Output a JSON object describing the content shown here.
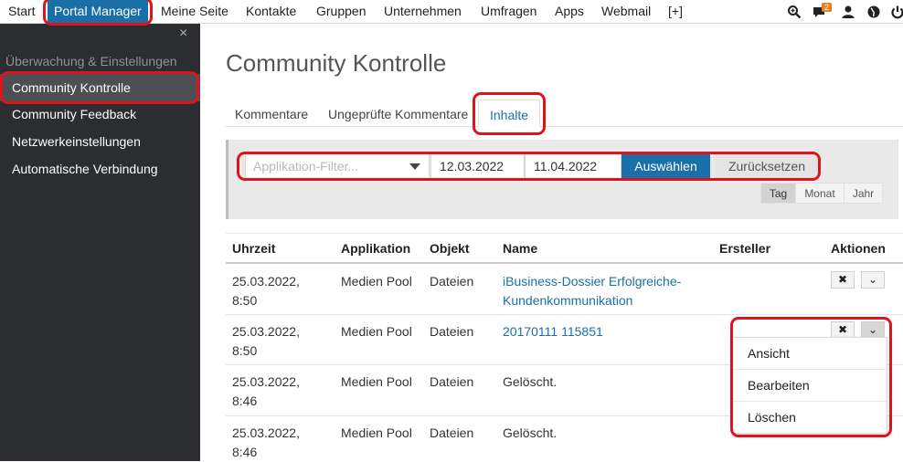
{
  "topbar": {
    "nav": [
      "Start",
      "Portal Manager",
      "Meine Seite",
      "Kontakte",
      "Gruppen",
      "Unternehmen",
      "Umfragen",
      "Apps",
      "Webmail",
      "[+]"
    ],
    "active_index": 1,
    "icons": [
      "zoom-icon",
      "chat-icon",
      "user-icon",
      "globe-icon",
      "power-icon"
    ],
    "chat_badge": "2",
    "accent_color": "#1b6fa8",
    "badge_color": "#f07d1a"
  },
  "sidebar": {
    "close_glyph": "×",
    "section_title": "Überwachung & Einstellungen",
    "items": [
      "Community Kontrolle",
      "Community Feedback",
      "Netzwerkeinstellungen",
      "Automatische Verbindung"
    ],
    "active_index": 0,
    "background": "#2b2d30"
  },
  "main": {
    "title": "Community Kontrolle",
    "tabs": [
      "Kommentare",
      "Ungeprüfte Kommentare",
      "Inhalte"
    ],
    "active_tab": 2
  },
  "filter": {
    "app_placeholder": "Applikation-Filter...",
    "date_from": "12.03.2022",
    "date_to": "11.04.2022",
    "select_button": "Auswählen",
    "reset_button": "Zurücksetzen",
    "granularity": [
      "Tag",
      "Monat",
      "Jahr"
    ],
    "active_granularity": 0
  },
  "table": {
    "headers": [
      "Uhrzeit",
      "Applikation",
      "Objekt",
      "Name",
      "Ersteller",
      "Aktionen"
    ],
    "rows": [
      {
        "time": "25.03.2022,",
        "hour": "8:50",
        "app": "Medien Pool",
        "object": "Dateien",
        "name1": "iBusiness-Dossier Erfolgreiche-",
        "name2": "Kundenkommunikation",
        "creator": "",
        "is_link": true
      },
      {
        "time": "25.03.2022,",
        "hour": "8:50",
        "app": "Medien Pool",
        "object": "Dateien",
        "name1": "20170111 115851",
        "name2": "",
        "creator": "",
        "is_link": true
      },
      {
        "time": "25.03.2022,",
        "hour": "8:46",
        "app": "Medien Pool",
        "object": "Dateien",
        "name1": "Gelöscht.",
        "name2": "",
        "creator": "",
        "is_link": false
      },
      {
        "time": "25.03.2022,",
        "hour": "8:46",
        "app": "Medien Pool",
        "object": "Dateien",
        "name1": "Gelöscht.",
        "name2": "",
        "creator": "",
        "is_link": false
      }
    ],
    "delete_glyph": "✖",
    "expand_glyph": "⌄"
  },
  "dropdown": {
    "items": [
      "Ansicht",
      "Bearbeiten",
      "Löschen"
    ]
  },
  "highlight_color": "#e0131b"
}
